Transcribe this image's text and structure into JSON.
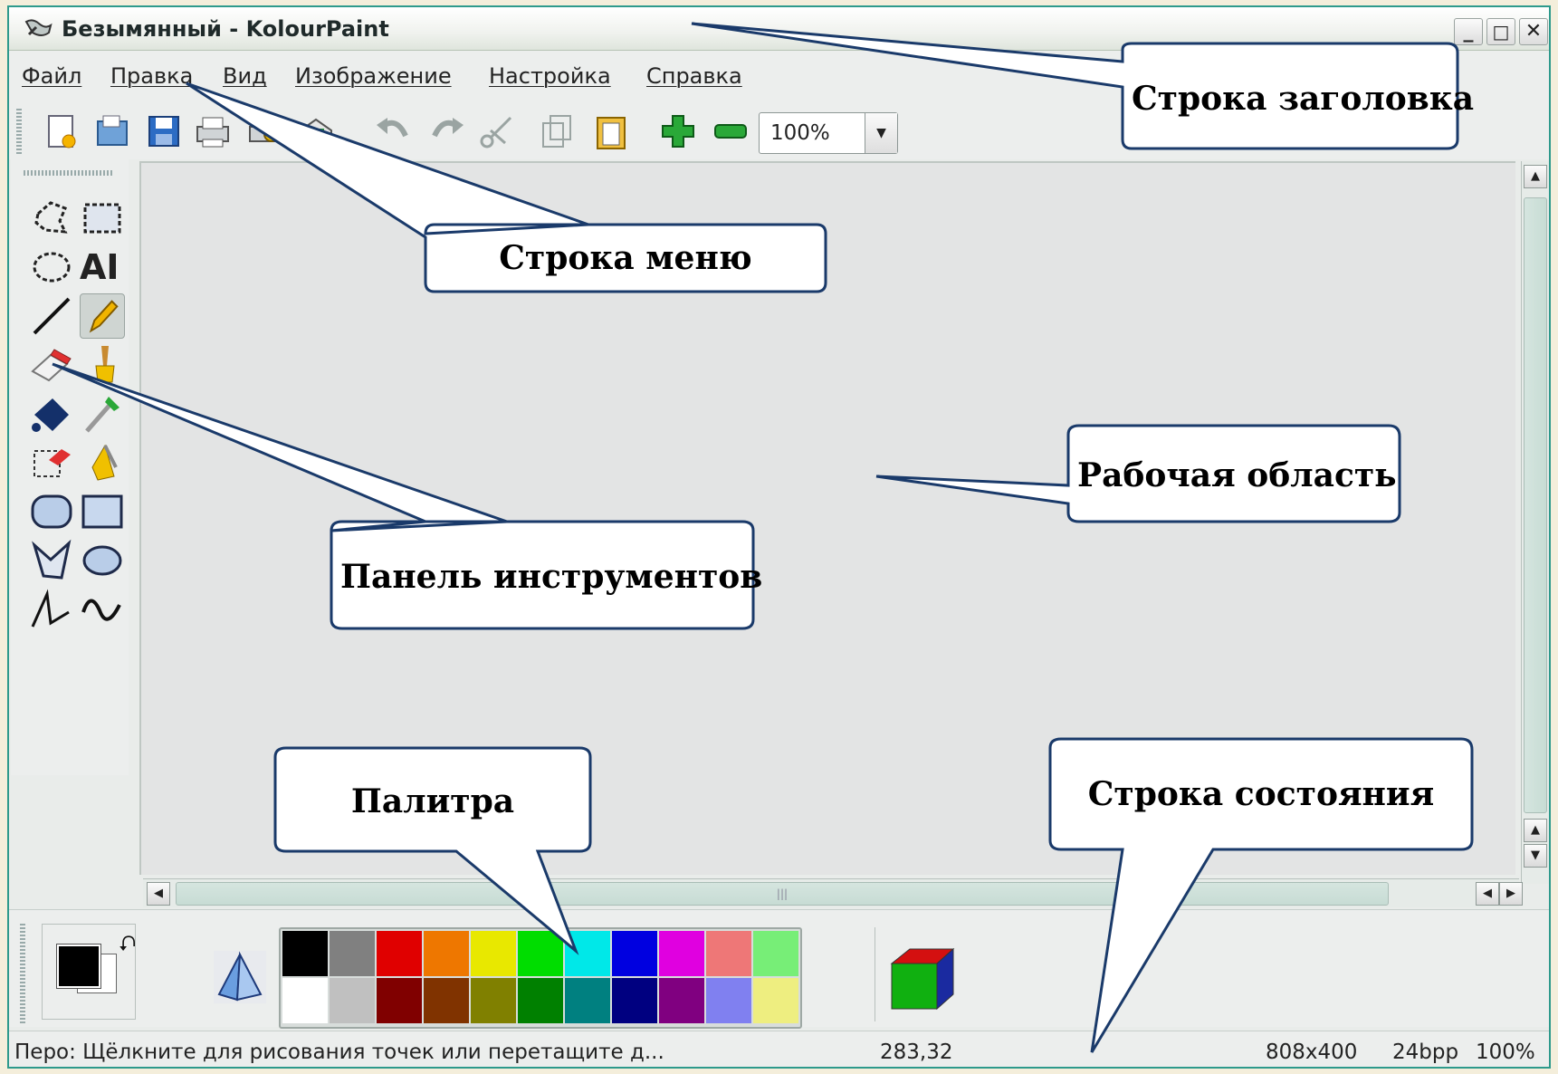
{
  "window": {
    "title": "Безымянный - KolourPaint",
    "minimize": "_",
    "maximize": "□",
    "close": "✕"
  },
  "menu": {
    "items": [
      "Файл",
      "Правка",
      "Вид",
      "Изображение",
      "Настройка",
      "Справка"
    ]
  },
  "toolbar": {
    "icons": [
      "new-icon",
      "open-icon",
      "save-icon",
      "print-icon",
      "print-preview-icon",
      "mail-icon",
      "undo-icon",
      "redo-icon",
      "cut-icon",
      "copy-icon",
      "paste-icon",
      "zoom-in-icon",
      "zoom-out-icon"
    ],
    "zoom_value": "100%",
    "zoom_arrow": "▼"
  },
  "tools": {
    "text_tool_glyph": "AI",
    "icons": [
      "free-form-select-icon",
      "rect-select-icon",
      "ellipse-select-icon",
      "text-icon",
      "line-icon",
      "pen-icon",
      "eraser-icon",
      "brush-icon",
      "flood-fill-icon",
      "color-picker-icon",
      "color-eraser-icon",
      "spraycan-icon",
      "rounded-rect-icon",
      "rect-icon",
      "polygon-icon",
      "ellipse-icon",
      "polyline-icon",
      "curve-icon"
    ],
    "active": "pen-icon"
  },
  "palette": {
    "row1": [
      "#000000",
      "#808080",
      "#e00000",
      "#ee7700",
      "#e8e800",
      "#00dd00",
      "#00e8e8",
      "#0000e0",
      "#e000e0",
      "#ee7777",
      "#77ee77"
    ],
    "row2": [
      "#ffffff",
      "#c0c0c0",
      "#800000",
      "#803300",
      "#808000",
      "#008000",
      "#008080",
      "#000080",
      "#800080",
      "#8080f0",
      "#eeee80"
    ]
  },
  "colors": {
    "foreground": "#000000",
    "background": "#ffffff",
    "frame_border": "#2e9a8c"
  },
  "statusbar": {
    "message": "Перо: Щёлкните для рисования точек или перетащите д...",
    "coords": "283,32",
    "size": "808x400",
    "depth": "24bpp",
    "zoom": "100%"
  },
  "callouts": {
    "title_bar": "Строка заголовка",
    "menu_bar": "Строка меню",
    "work_area": "Рабочая область",
    "toolbox": "Панель инструментов",
    "palette": "Палитра",
    "status_bar": "Строка состояния"
  }
}
